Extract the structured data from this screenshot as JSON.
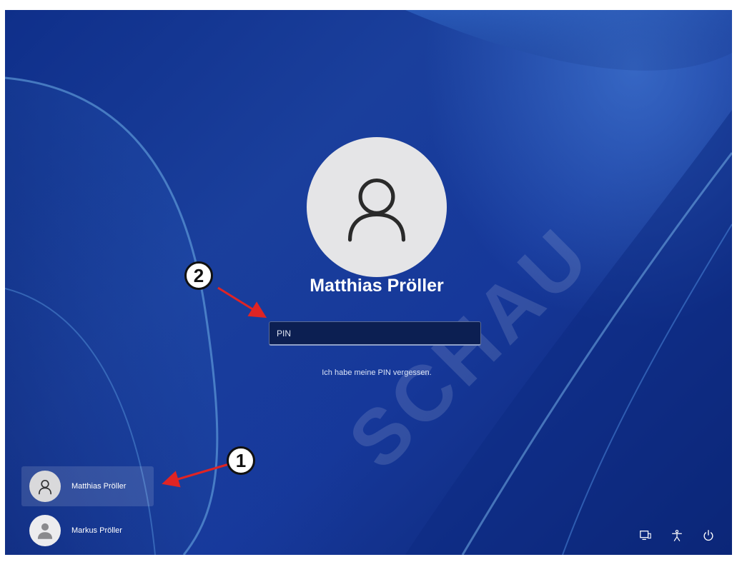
{
  "lock_screen": {
    "current_user": "Matthias Pröller",
    "pin_placeholder": "PIN",
    "forgot_pin": "Ich habe meine PIN vergessen."
  },
  "user_list": [
    {
      "name": "Matthias Pröller",
      "selected": true,
      "avatar_icon": "person-outline-icon"
    },
    {
      "name": "Markus Pröller",
      "selected": false,
      "avatar_icon": "person-filled-icon"
    }
  ],
  "system_icons": [
    "network-icon",
    "accessibility-icon",
    "power-icon"
  ],
  "annotations": {
    "badge_1": "1",
    "badge_2": "2",
    "arrow_color": "#e02424"
  },
  "watermark": "SCHAU",
  "colors": {
    "background": "#1a3f9c",
    "avatar_bg": "#e5e5e7",
    "pin_box_bg": "#0c1f52"
  }
}
